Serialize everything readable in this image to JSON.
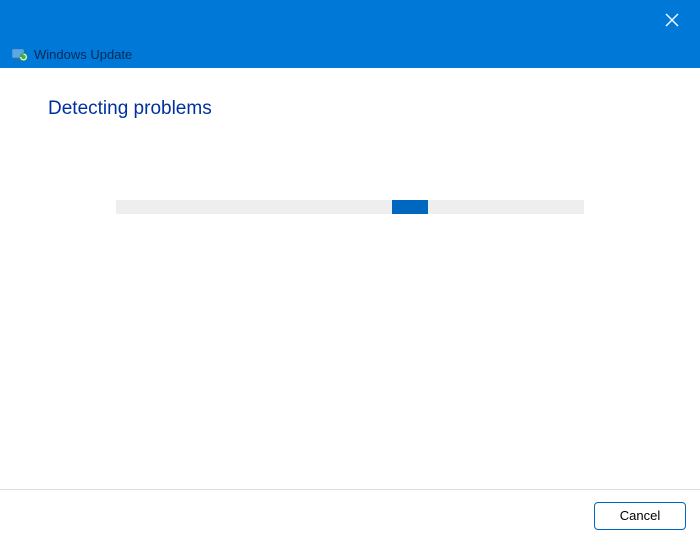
{
  "header": {
    "title": "Windows Update"
  },
  "main": {
    "heading": "Detecting problems"
  },
  "footer": {
    "cancel_label": "Cancel"
  }
}
